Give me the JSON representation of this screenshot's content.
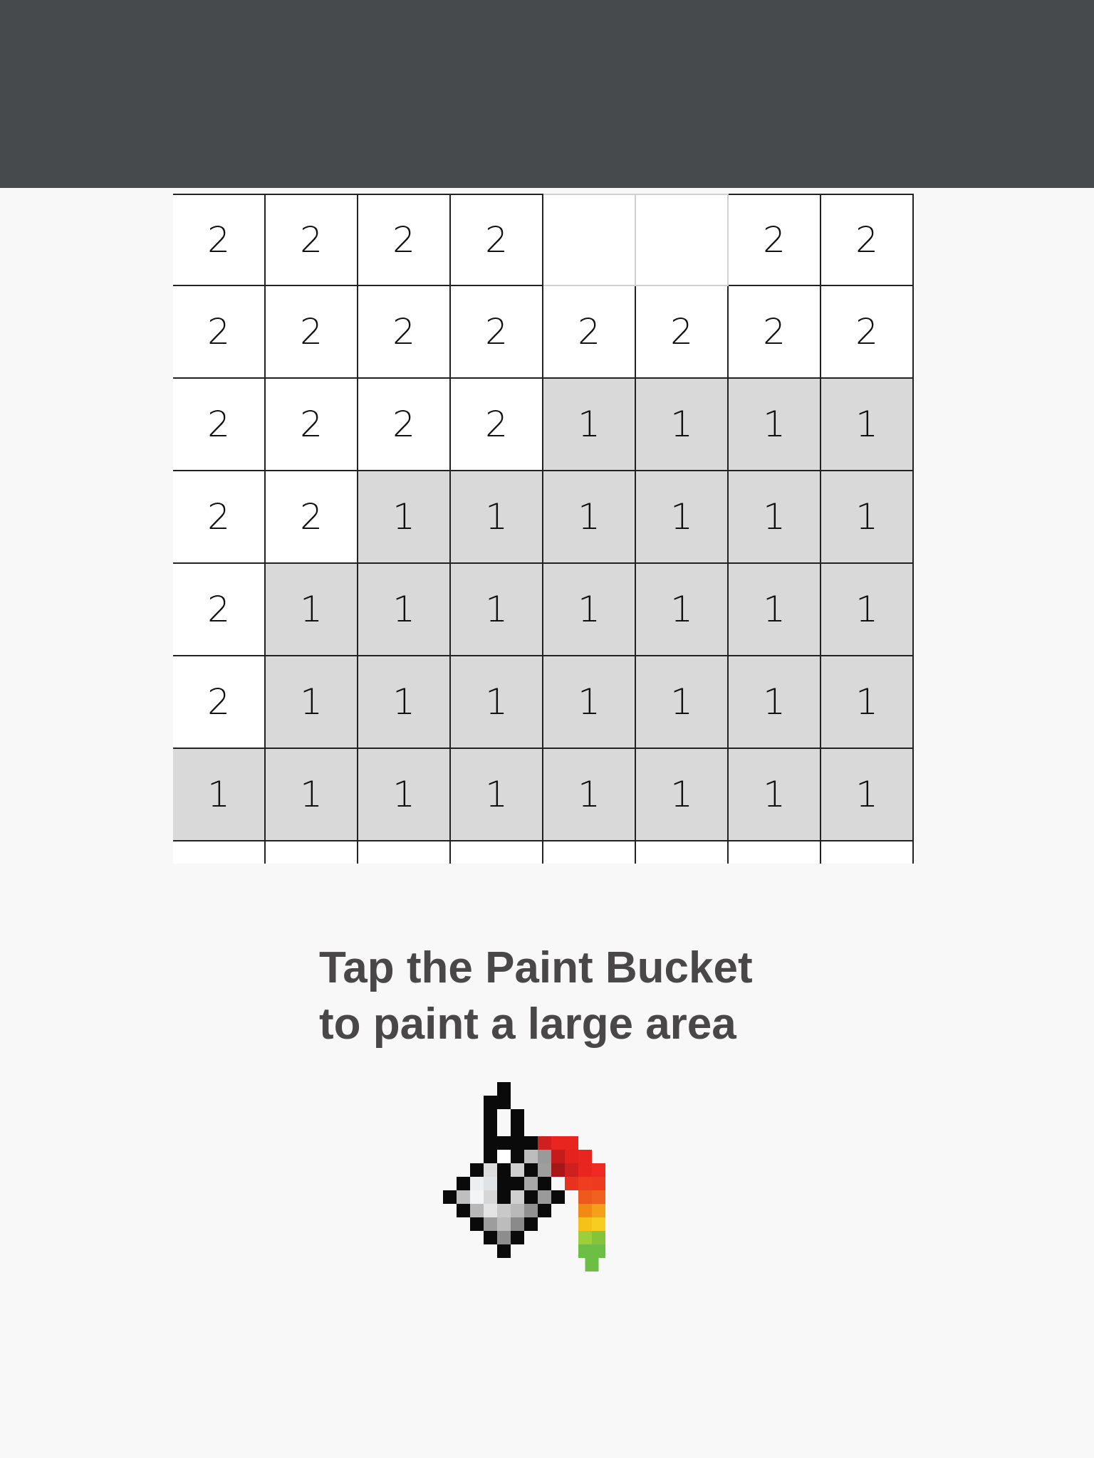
{
  "grid": {
    "rows": [
      [
        "2",
        "2",
        "2",
        "2",
        "",
        "",
        "2",
        "2"
      ],
      [
        "2",
        "2",
        "2",
        "2",
        "2",
        "2",
        "2",
        "2"
      ],
      [
        "2",
        "2",
        "2",
        "2",
        "1",
        "1",
        "1",
        "1"
      ],
      [
        "2",
        "2",
        "1",
        "1",
        "1",
        "1",
        "1",
        "1"
      ],
      [
        "2",
        "1",
        "1",
        "1",
        "1",
        "1",
        "1",
        "1"
      ],
      [
        "2",
        "1",
        "1",
        "1",
        "1",
        "1",
        "1",
        "1"
      ],
      [
        "1",
        "1",
        "1",
        "1",
        "1",
        "1",
        "1",
        "1"
      ],
      [
        "",
        "",
        "",
        "",
        "",
        "",
        "",
        ""
      ]
    ],
    "colors": {
      "1": "#d9d9d9",
      "2": "#ffffff",
      "painted": "#ffffff"
    }
  },
  "instruction": {
    "line1": "Tap the Paint Bucket",
    "line2": "to paint a large area"
  },
  "icons": {
    "tool": "paint-bucket-icon"
  },
  "theme": {
    "topbar": "#464a4c",
    "background": "#f8f8f8",
    "text": "#4a4748"
  }
}
